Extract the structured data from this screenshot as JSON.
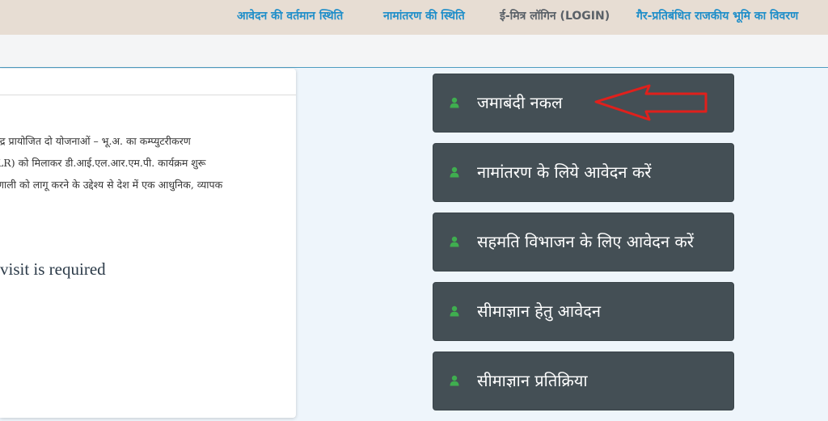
{
  "topnav": {
    "links": [
      {
        "label": "आवेदन की वर्तमान स्थिति"
      },
      {
        "label": "नामांतरण की स्थिति"
      },
      {
        "label": "ई-मित्र लॉगिन (LOGIN)"
      },
      {
        "label": "गैर-प्रतिबंधित राजकीय भूमि का विवरण"
      }
    ]
  },
  "info": {
    "lines": [
      "न्द्र प्रायोजित दो योजनाओं – भू.अ. का कम्प्युटरीकरण",
      "LR) को मिलाकर डी.आई.एल.आर.एम.पी. कार्यक्रम शुरू",
      "णाली को लागू करने के उद्देश्य से देश में एक आधुनिक, व्यापक"
    ],
    "visit_text": "visit is required"
  },
  "services": [
    {
      "label": "जमाबंदी नकल",
      "icon": "user-icon"
    },
    {
      "label": "नामांतरण के लिये आवेदन करें",
      "icon": "user-icon"
    },
    {
      "label": "सहमति विभाजन के लिए आवेदन करें",
      "icon": "user-icon"
    },
    {
      "label": "सीमाज्ञान हेतु आवेदन",
      "icon": "user-icon"
    },
    {
      "label": "सीमाज्ञान प्रतिक्रिया",
      "icon": "user-icon"
    }
  ],
  "colors": {
    "topnav_bg": "#e7ddd3",
    "link": "#1f8ec9",
    "service_button": "#444f55",
    "service_icon": "#3fae4f",
    "annotation_arrow": "#e0201c"
  }
}
